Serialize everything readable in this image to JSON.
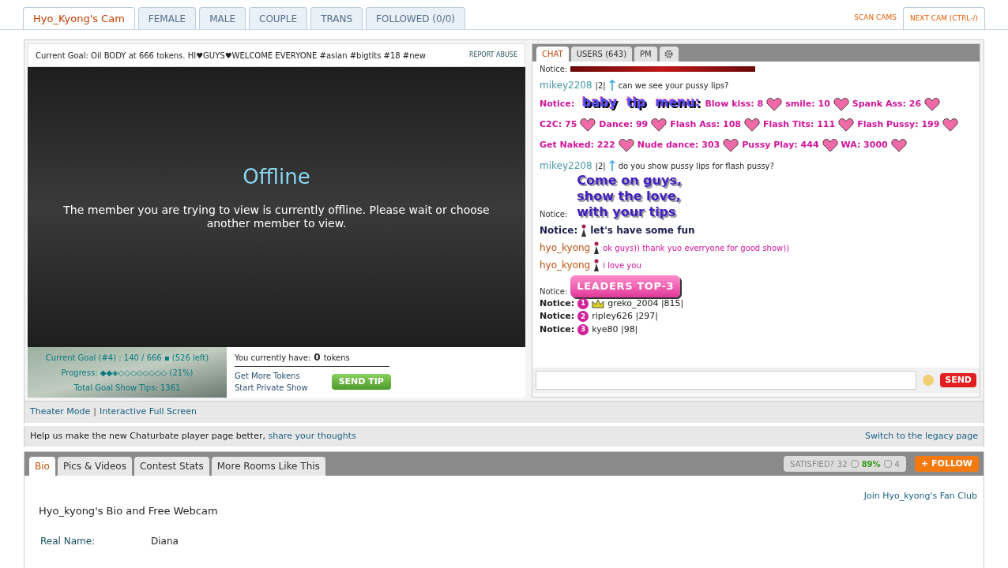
{
  "top_tabs": [
    {
      "label": "Hyo_Kyong's Cam",
      "selected": true
    },
    {
      "label": "FEMALE",
      "selected": false
    },
    {
      "label": "MALE",
      "selected": false
    },
    {
      "label": "COUPLE",
      "selected": false
    },
    {
      "label": "TRANS",
      "selected": false
    },
    {
      "label": "FOLLOWED (0/0)",
      "selected": false
    }
  ],
  "top_links": [
    "SCAN CAMS",
    "NEXT CAM (CTRL-/)"
  ],
  "player": {
    "goal": "Current Goal: Oil BODY at 666 tokens. HI♥GUYS♥WELCOME EVERYONE #asian #bigtits #18 #new",
    "report": "REPORT ABUSE",
    "offline_title": "Offline",
    "offline_message": "The member you are trying to view is currently offline. Please wait or choose another member to view."
  },
  "goal_box": {
    "lines": [
      "Current Goal (#4) : 140 / 666 ▪ (526 left)",
      "Progress: ◆◆◈◇◇◇◇◇◇◇◇ (21%)",
      "Total Goal Show Tips: 1361"
    ]
  },
  "tokens": {
    "label": "You currently have:",
    "count": "0",
    "unit": "tokens",
    "links": [
      "Get More Tokens",
      "Start Private Show"
    ],
    "send_tip": "SEND TIP"
  },
  "chat_tabs": [
    {
      "label": "CHAT",
      "selected": true
    },
    {
      "label": "USERS (643)",
      "selected": false
    },
    {
      "label": "PM",
      "selected": false
    }
  ],
  "messages": [
    {
      "kind": "bar",
      "label": "Notice:"
    },
    {
      "kind": "user",
      "user": "mikey2208",
      "badge": "|2|",
      "text": "can we see your pussy lips?"
    },
    {
      "kind": "menu",
      "label": "Notice:",
      "banner": [
        "baby",
        "tip",
        "menu:"
      ],
      "items": [
        "Blow kiss: 8",
        "smile: 10",
        "Spank Ass: 26",
        "C2C: 75",
        "Dance: 99",
        "Flash Ass: 108",
        "Flash Tits: 111",
        "Flash Pussy: 199",
        "Get Naked: 222",
        "Nude dance: 303",
        "Pussy Play: 444",
        "WA: 3000"
      ]
    },
    {
      "kind": "user",
      "user": "mikey2208",
      "badge": "|2|",
      "text": "do you show pussy lips for flash pussy?"
    },
    {
      "kind": "banner",
      "label": "Notice:",
      "lines": [
        "Come on guys,",
        "show the love,",
        "with your tips"
      ]
    },
    {
      "kind": "notice",
      "label": "Notice:",
      "text": "let's have some fun"
    },
    {
      "kind": "model",
      "user": "hyo_kyong",
      "text": "ok guys)) thank yuo everryone for good show))"
    },
    {
      "kind": "model",
      "user": "hyo_kyong",
      "text": "i love you"
    },
    {
      "kind": "button_banner",
      "label": "Notice:",
      "text": "LEADERS TOP-3"
    },
    {
      "kind": "leader",
      "label": "Notice:",
      "rank": "1",
      "crown": true,
      "text": "greko_2004 |815|"
    },
    {
      "kind": "leader",
      "label": "Notice:",
      "rank": "2",
      "crown": false,
      "text": "ripley626 |297|"
    },
    {
      "kind": "leader",
      "label": "Notice:",
      "rank": "3",
      "crown": false,
      "text": "kye80 |98|"
    }
  ],
  "send": "SEND",
  "links_row": [
    "Theater Mode",
    "|",
    "Interactive Full Screen"
  ],
  "feedback": {
    "text": "Help us make the new Chaturbate player page better,",
    "link": "share your thoughts",
    "legacy": "Switch to the legacy page"
  },
  "bio_tabs": [
    {
      "label": "Bio",
      "selected": true
    },
    {
      "label": "Pics & Videos",
      "selected": false
    },
    {
      "label": "Contest Stats",
      "selected": false
    },
    {
      "label": "More Rooms Like This",
      "selected": false
    }
  ],
  "satisfied": {
    "label": "SATISFIED?",
    "up": "32",
    "percent": "89%",
    "down": "4"
  },
  "follow": "+ FOLLOW",
  "fan_club": "Join Hyo_kyong's Fan Club",
  "bio": {
    "title": "Hyo_kyong's Bio and Free Webcam",
    "fields": [
      {
        "label": "Real Name:",
        "value": "Diana"
      }
    ]
  }
}
